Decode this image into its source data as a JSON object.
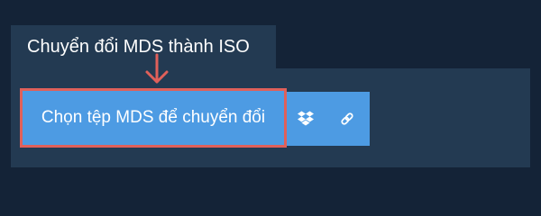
{
  "page": {
    "title": "Chuyển đổi MDS thành ISO"
  },
  "upload": {
    "choose_label": "Chọn tệp MDS để chuyển đổi",
    "dropbox_icon": "dropbox-icon",
    "link_icon": "link-icon"
  },
  "colors": {
    "background": "#142337",
    "panel": "#233a52",
    "button": "#4d9be3",
    "highlight": "#e0605a",
    "text": "#ffffff"
  }
}
